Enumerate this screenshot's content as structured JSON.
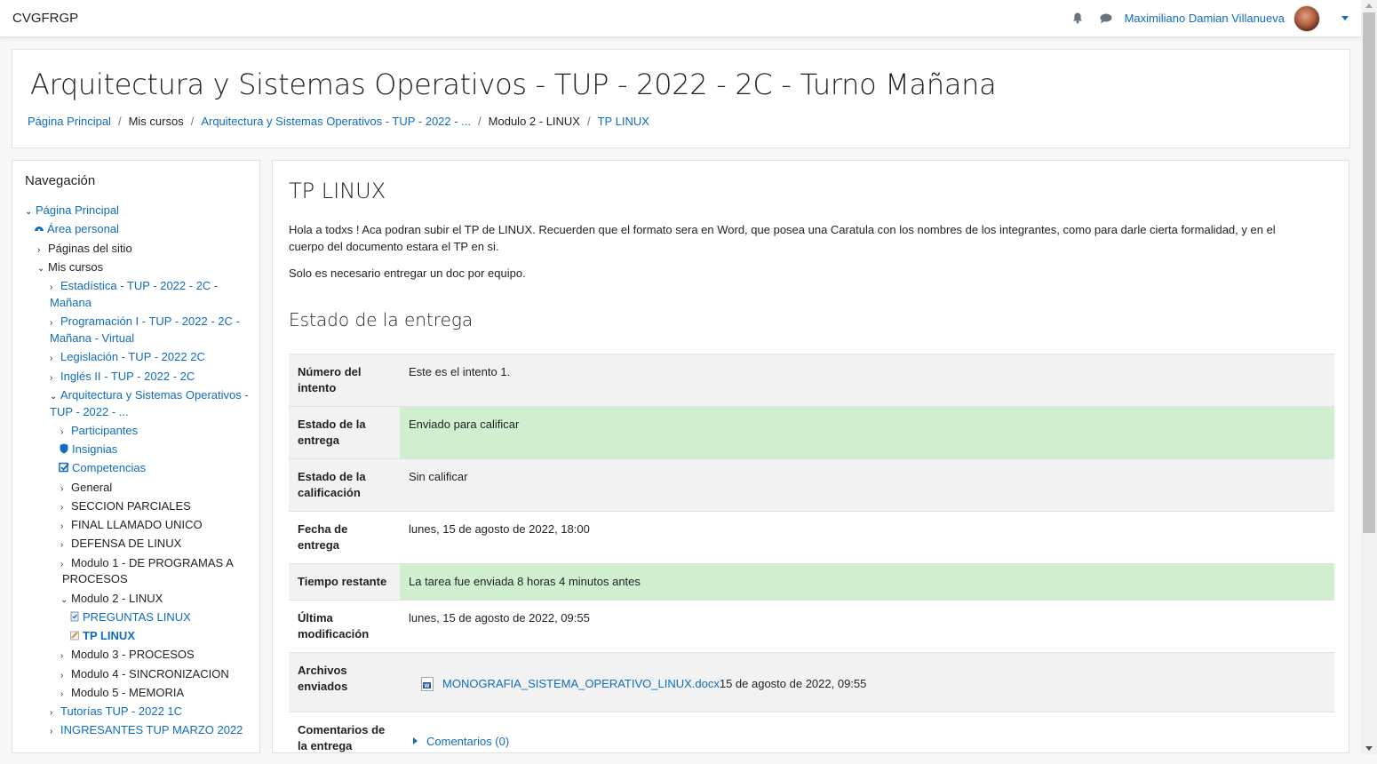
{
  "navbar": {
    "brand": "CVGFRGP",
    "user_name": "Maximiliano Damian Villanueva",
    "icons": [
      "bell-icon",
      "chat-icon"
    ]
  },
  "header": {
    "title": "Arquitectura y Sistemas Operativos - TUP - 2022 - 2C - Turno Mañana",
    "breadcrumb": [
      {
        "label": "Página Principal",
        "link": true
      },
      {
        "label": "Mis cursos",
        "link": false
      },
      {
        "label": "Arquitectura y Sistemas Operativos - TUP - 2022 - ...",
        "link": true
      },
      {
        "label": "Modulo 2 - LINUX",
        "link": false
      },
      {
        "label": "TP LINUX",
        "link": true
      }
    ]
  },
  "navigation": {
    "title": "Navegación",
    "items": {
      "home": "Página Principal",
      "dashboard": "Área personal",
      "site_pages": "Páginas del sitio",
      "my_courses": "Mis cursos",
      "course1_a": "Estadística - TUP - 2022 - 2C -",
      "course1_b": "Mañana",
      "course2_a": "Programación I - TUP - 2022 - 2C -",
      "course2_b": "Mañana - Virtual",
      "course3": "Legislación - TUP - 2022 2C",
      "course4": "Inglés II - TUP - 2022 - 2C",
      "course5_a": "Arquitectura y Sistemas Operativos -",
      "course5_b": "TUP - 2022 - ...",
      "participants": "Participantes",
      "badges": "Insignias",
      "competencies": "Competencias",
      "general": "General",
      "sec_parciales": "SECCION PARCIALES",
      "final": "FINAL LLAMADO UNICO",
      "defensa": "DEFENSA DE LINUX",
      "mod1_a": "Modulo 1 - DE PROGRAMAS A",
      "mod1_b": "PROCESOS",
      "mod2": "Modulo 2 - LINUX",
      "preguntas": "PREGUNTAS LINUX",
      "tp_linux": "TP LINUX",
      "mod3": "Modulo 3 - PROCESOS",
      "mod4": "Modulo 4 - SINCRONIZACION",
      "mod5": "Modulo 5 - MEMORIA",
      "tutorias": "Tutorías TUP - 2022 1C",
      "ingresantes": "INGRESANTES TUP MARZO 2022"
    }
  },
  "main": {
    "title": "TP LINUX",
    "intro": "Hola a todxs ! Aca podran subir el TP de LINUX. Recuerden que el formato sera en Word, que posea una Caratula con los nombres de los integrantes, como para darle cierta formalidad, y en el cuerpo del documento estara el TP en si.",
    "intro2": "Solo es necesario entregar un doc por equipo.",
    "status_heading": "Estado de la entrega",
    "rows": {
      "attempt_label": "Número del intento",
      "attempt_value": "Este es el intento 1.",
      "submission_label": "Estado de la entrega",
      "submission_value": "Enviado para calificar",
      "grading_label": "Estado de la calificación",
      "grading_value": "Sin calificar",
      "due_label": "Fecha de entrega",
      "due_value": "lunes, 15 de agosto de 2022, 18:00",
      "remaining_label": "Tiempo restante",
      "remaining_value": "La tarea fue enviada 8 horas 4 minutos antes",
      "modified_label": "Última modificación",
      "modified_value": "lunes, 15 de agosto de 2022, 09:55",
      "files_label": "Archivos enviados",
      "file_name": "MONOGRAFIA_SISTEMA_OPERATIVO_LINUX.docx",
      "file_date": "15 de agosto de 2022, 09:55",
      "comments_label": "Comentarios de la entrega",
      "comments_link": "Comentarios (0)"
    }
  },
  "colors": {
    "link": "#0f6cbf",
    "success_bg": "#cfefcf",
    "stripe_bg": "#f2f2f2"
  }
}
